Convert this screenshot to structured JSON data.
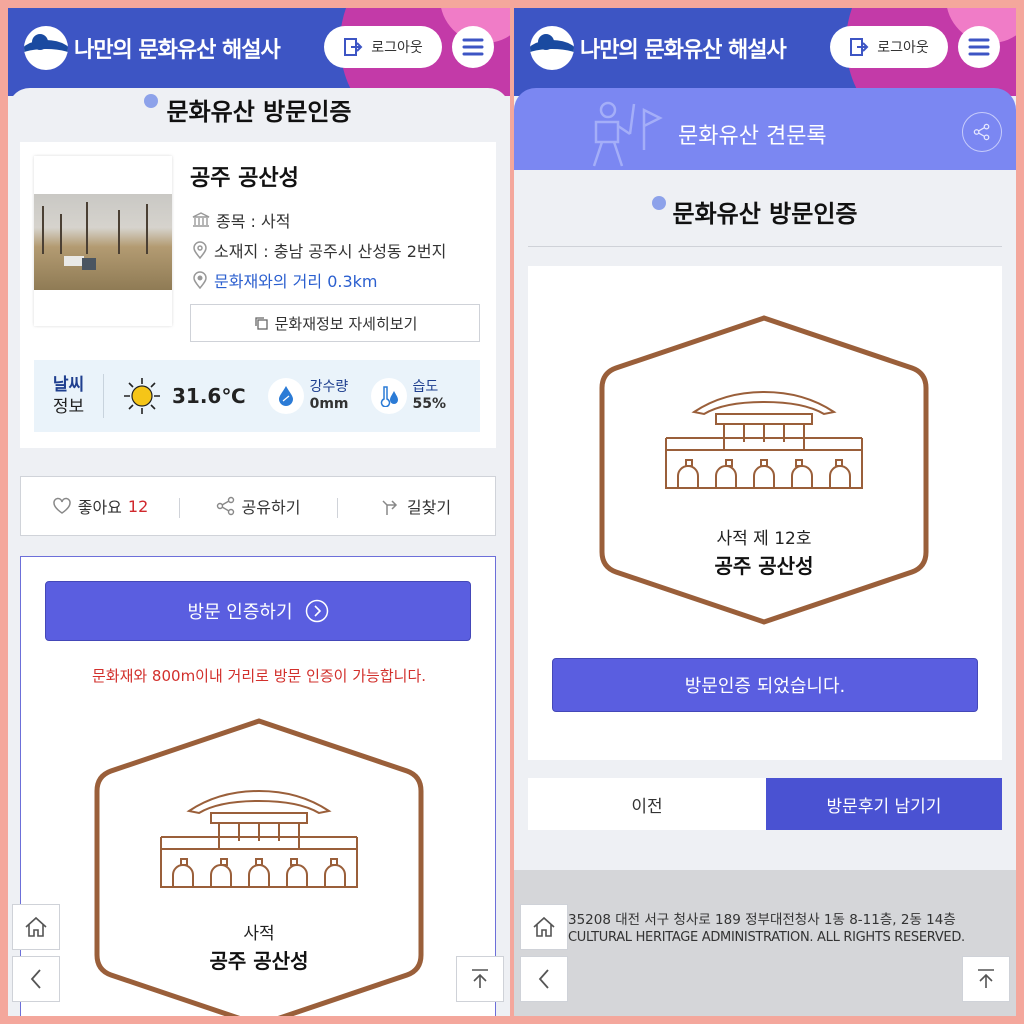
{
  "header": {
    "brand": "나만의 문화유산 해설사",
    "logout_label": "로그아웃"
  },
  "left": {
    "section_title": "문화유산 방문인증",
    "heritage": {
      "name": "공주 공산성",
      "type": "종목 : 사적",
      "location": "소재지 : 충남 공주시 산성동 2번지",
      "distance": "문화재와의 거리 0.3km",
      "detail_label": "문화재정보 자세히보기"
    },
    "weather": {
      "label_top": "날씨",
      "label_bottom": "정보",
      "temperature": "31.6℃",
      "rain_label": "강수량",
      "rain_value": "0mm",
      "humidity_label": "습도",
      "humidity_value": "55%"
    },
    "actions": {
      "like_label": "좋아요",
      "like_count": "12",
      "share_label": "공유하기",
      "route_label": "길찾기"
    },
    "cert": {
      "button_label": "방문 인증하기",
      "notice": "문화재와 800m이내 거리로 방문 인증이 가능합니다.",
      "badge_subtitle": "사적",
      "badge_name": "공주 공산성"
    }
  },
  "right": {
    "band_title": "문화유산 견문록",
    "section_title": "문화유산 방문인증",
    "badge_subtitle": "사적 제 12호",
    "badge_name": "공주 공산성",
    "done_label": "방문인증 되었습니다.",
    "prev_label": "이전",
    "review_label": "방문후기 남기기",
    "footer_address": "35208 대전 서구 청사로 189 정부대전청사 1동 8-11층, 2동 14층",
    "footer_copyright": "CULTURAL HERITAGE ADMINISTRATION. ALL RIGHTS RESERVED."
  },
  "colors": {
    "header_blue": "#3d55c4",
    "accent_purple": "#5a5ee0",
    "band_purple": "#7b87f2",
    "badge_brown": "#9a5f3a",
    "notice_red": "#d2302c"
  }
}
